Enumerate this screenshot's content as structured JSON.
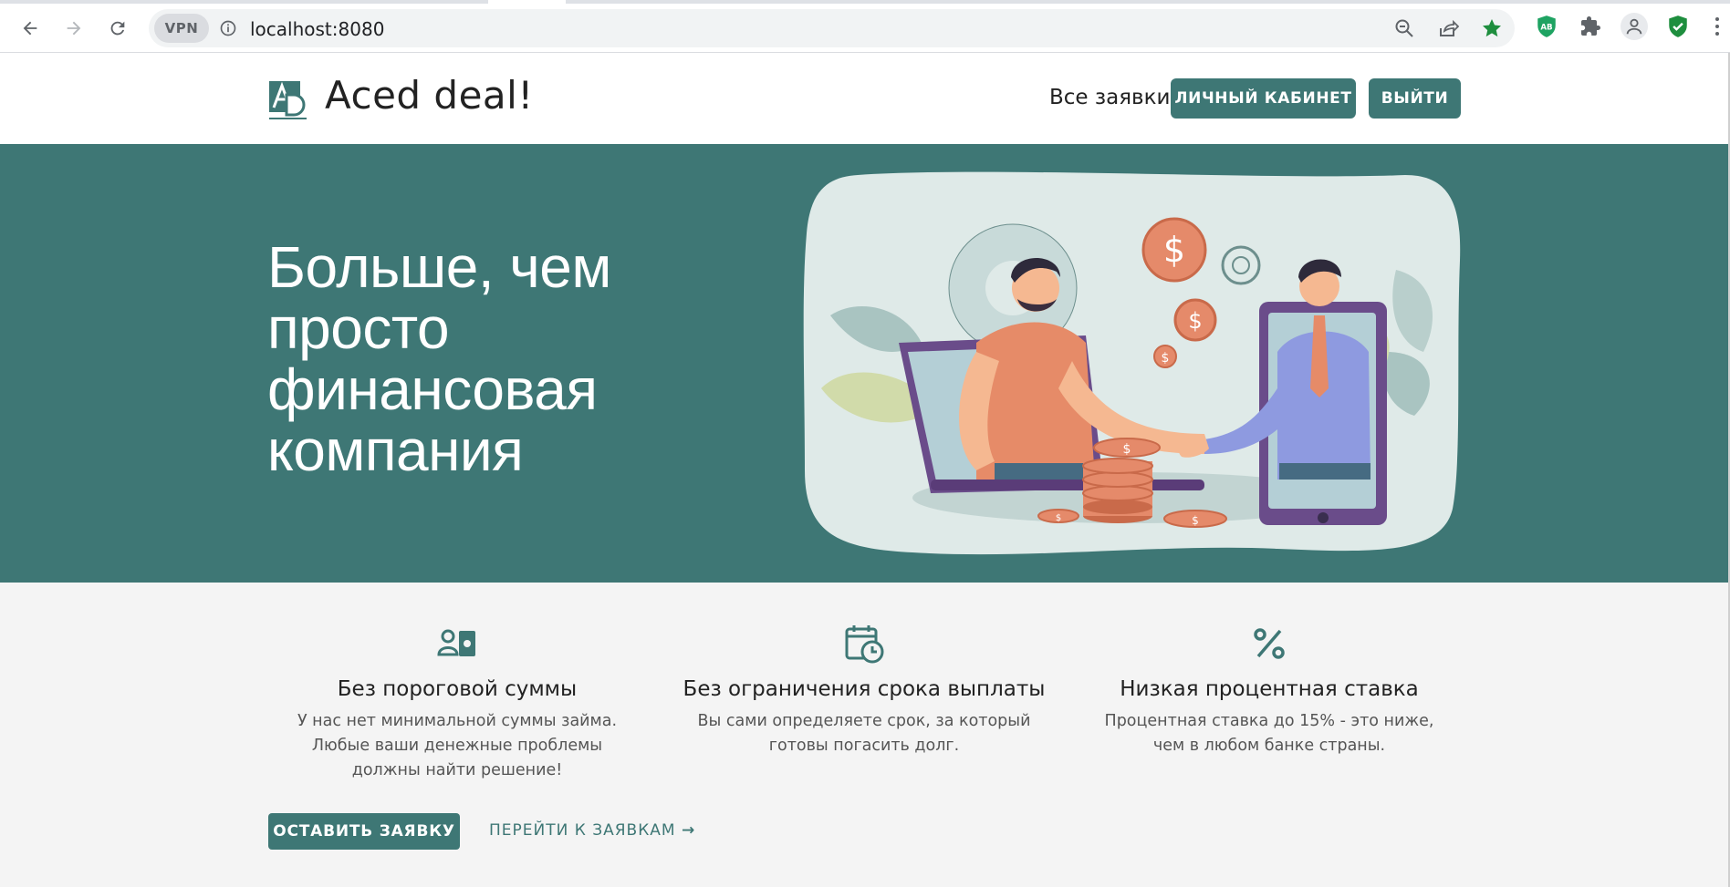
{
  "browser": {
    "url": "localhost:8080",
    "vpn_label": "VPN",
    "extensions": [
      "ab-extension-icon",
      "puzzle-icon",
      "profile-icon",
      "shield-check-icon"
    ]
  },
  "header": {
    "logo_text": "Aced deal!",
    "nav_all_requests": "Все заявки",
    "cabinet_button": "ЛИЧНЫЙ КАБИНЕТ",
    "logout_button": "ВЫЙТИ"
  },
  "hero": {
    "title_lines": [
      "Больше, чем",
      "просто",
      "финансовая",
      "компания"
    ]
  },
  "features": [
    {
      "icon": "user-money-icon",
      "title": "Без пороговой суммы",
      "description": "У нас нет минимальной суммы займа. Любые ваши денежные проблемы должны найти решение!"
    },
    {
      "icon": "calendar-clock-icon",
      "title": "Без ограничения срока выплаты",
      "description": "Вы сами определяете срок, за который готовы погасить долг."
    },
    {
      "icon": "percent-icon",
      "title": "Низкая процентная ставка",
      "description": "Процентная ставка до 15% - это ниже, чем в любом банке страны."
    }
  ],
  "actions": {
    "submit_request": "ОСТАВИТЬ ЗАЯВКУ",
    "go_to_requests": "ПЕРЕЙТИ К ЗАЯВКАМ",
    "go_arrow": "→"
  },
  "colors": {
    "brand": "#3e7775",
    "features_bg": "#f4f4f4",
    "coin": "#e58a6a"
  }
}
